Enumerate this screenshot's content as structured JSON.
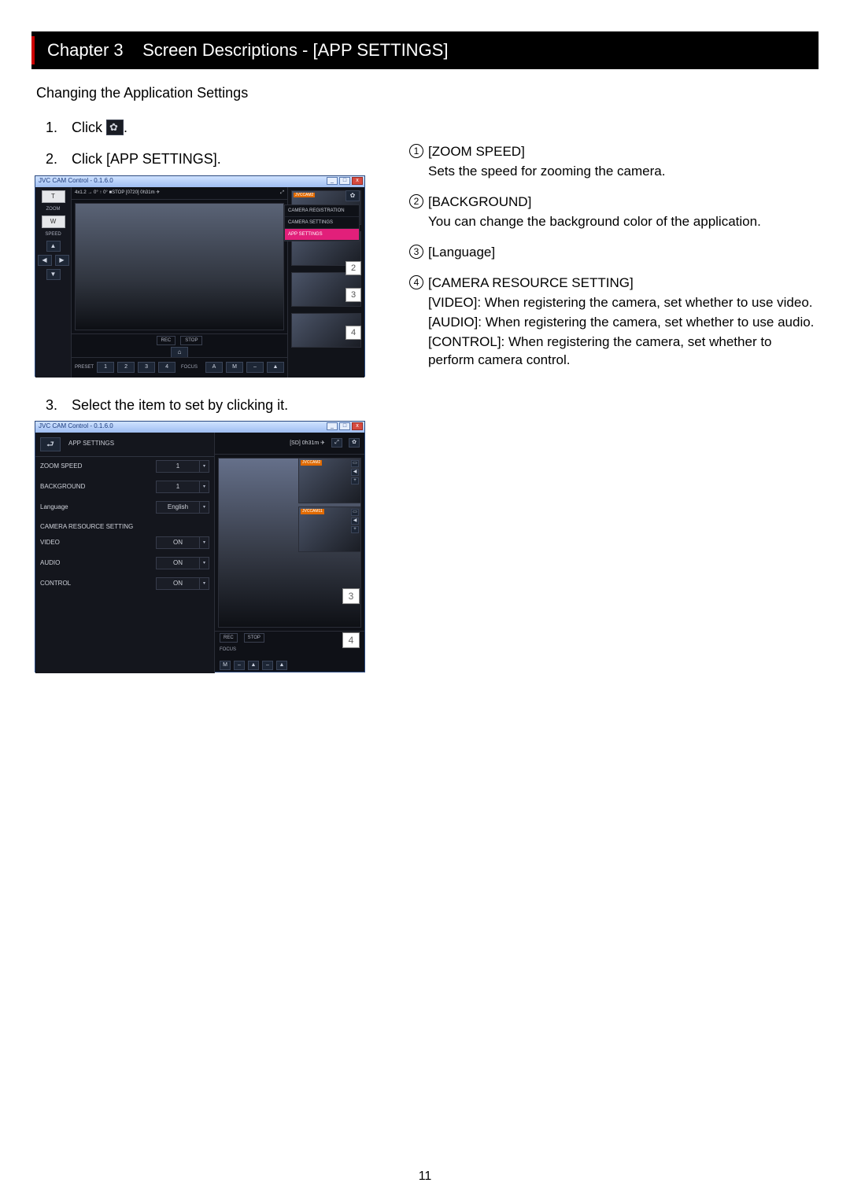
{
  "page_number": "11",
  "chapter": {
    "label": "Chapter 3",
    "title": "Screen Descriptions - [APP SETTINGS]"
  },
  "subtitle": "Changing the Application Settings",
  "steps": {
    "s1_prefix": "Click ",
    "s1_suffix": ".",
    "s2": "Click [APP SETTINGS].",
    "s3": "Select the item to set by clicking it."
  },
  "shot1": {
    "window_title": "JVC CAM Control - 0.1.6.0",
    "zoom_t": "T",
    "zoom_label": "ZOOM",
    "zoom_w": "W",
    "speed": "SPEED",
    "topstrip": "4x1.2  →  0°  ↑  0°   ■STOP  [0720]  0h31m  ✈",
    "rec": "REC",
    "stop": "STOP",
    "preset": "PRESET",
    "focus": "FOCUS",
    "presets": [
      "1",
      "2",
      "3",
      "4"
    ],
    "af": "A",
    "mf": "M",
    "home": "⌂",
    "expand": "⤢",
    "gear": "✿",
    "menu": {
      "reg": "CAMERA REGISTRATION",
      "cam": "CAMERA SETTINGS",
      "app": "APP SETTINGS"
    },
    "cam_tag": "JVCCAM2",
    "badges": {
      "b2": "2",
      "b3": "3",
      "b4": "4"
    }
  },
  "shot2": {
    "window_title": "JVC CAM Control - 0.1.6.0",
    "header": "APP SETTINGS",
    "rows": {
      "zoom_speed": {
        "label": "ZOOM SPEED",
        "value": "1"
      },
      "background": {
        "label": "BACKGROUND",
        "value": "1"
      },
      "language": {
        "label": "Language",
        "value": "English"
      },
      "section": "CAMERA RESOURCE SETTING",
      "video": {
        "label": "VIDEO",
        "value": "ON"
      },
      "audio": {
        "label": "AUDIO",
        "value": "ON"
      },
      "control": {
        "label": "CONTROL",
        "value": "ON"
      }
    },
    "rtop_time": "[SD]  0h31m  ✈",
    "rec": "REC",
    "stop": "STOP",
    "focus": "FOCUS",
    "mf_m": "M",
    "cam_tags": [
      "JVCCAM2",
      "JVCCAM11"
    ],
    "badges": {
      "b3": "3",
      "b4": "4"
    }
  },
  "descriptions": {
    "d1": {
      "num": "1",
      "title": "[ZOOM SPEED]",
      "body": "Sets the speed for zooming the camera."
    },
    "d2": {
      "num": "2",
      "title": "[BACKGROUND]",
      "body": "You can change the background color of the application."
    },
    "d3": {
      "num": "3",
      "title": "[Language]"
    },
    "d4": {
      "num": "4",
      "title": "[CAMERA RESOURCE SETTING]",
      "line1": "[VIDEO]: When registering the camera, set whether to use video.",
      "line2": "[AUDIO]: When registering the camera, set whether to use audio.",
      "line3": "[CONTROL]: When registering the camera, set whether to perform camera control."
    }
  }
}
